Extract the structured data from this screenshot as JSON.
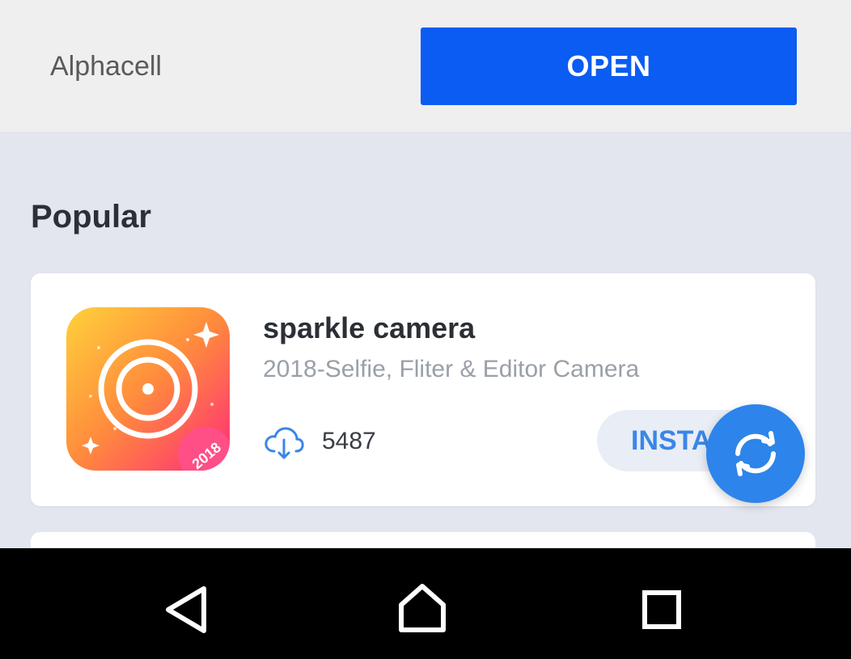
{
  "header": {
    "app_name": "Alphacell",
    "open_label": "OPEN"
  },
  "section": {
    "title": "Popular"
  },
  "apps": [
    {
      "title": "sparkle camera",
      "subtitle": "2018-Selfie, Fliter & Editor Camera",
      "downloads": "5487",
      "install_label": "INSTALL",
      "icon_badge": "2018",
      "icon": "camera-lens-icon"
    }
  ],
  "fab": {
    "icon": "refresh-icon"
  },
  "nav": {
    "back_icon": "back-triangle-icon",
    "home_icon": "home-icon",
    "recents_icon": "recents-square-icon"
  },
  "colors": {
    "accent": "#0b5cf2",
    "fab": "#2d84ea",
    "install_text": "#3a86e8",
    "background": "#e3e6ef"
  }
}
